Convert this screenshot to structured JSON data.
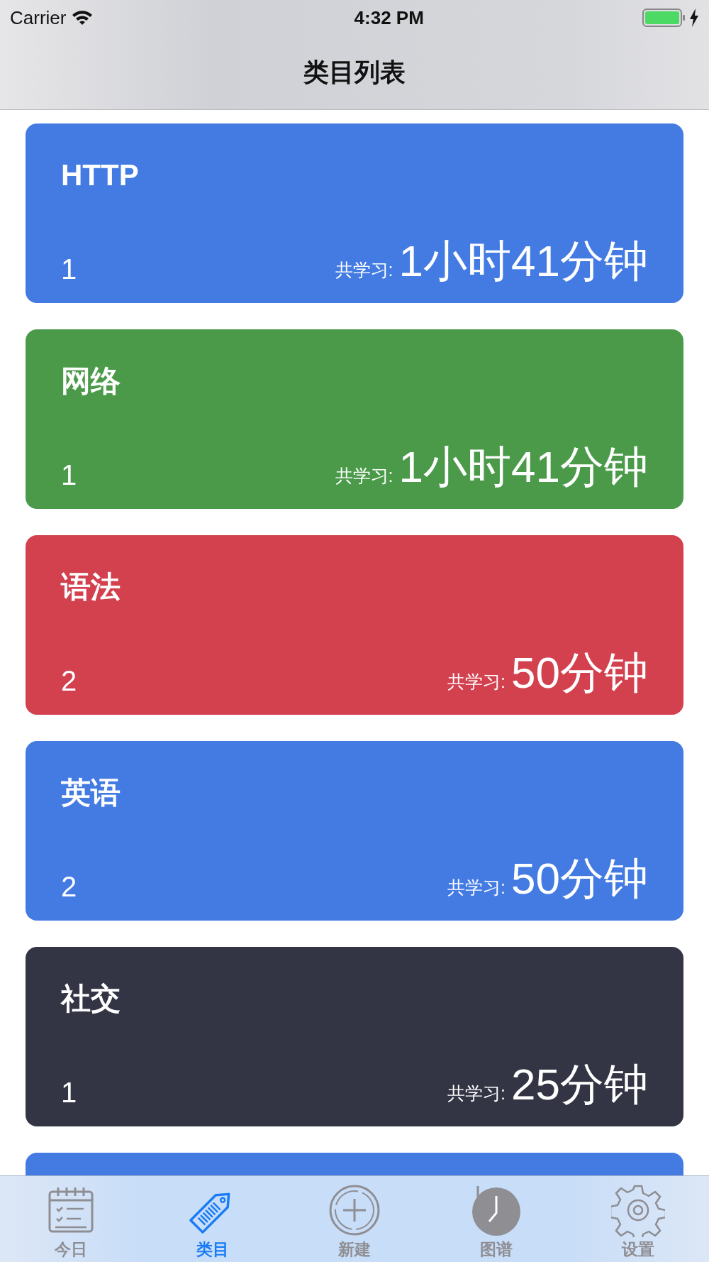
{
  "status_bar": {
    "carrier": "Carrier",
    "time": "4:32 PM"
  },
  "nav_bar": {
    "title": "类目列表"
  },
  "categories": [
    {
      "title": "HTTP",
      "count": "1",
      "label": "共学习:",
      "duration": "1小时41分钟",
      "color": "#437be3"
    },
    {
      "title": "网络",
      "count": "1",
      "label": "共学习:",
      "duration": "1小时41分钟",
      "color": "#4a9a4a"
    },
    {
      "title": "语法",
      "count": "2",
      "label": "共学习:",
      "duration": "50分钟",
      "color": "#d3414f"
    },
    {
      "title": "英语",
      "count": "2",
      "label": "共学习:",
      "duration": "50分钟",
      "color": "#437be3"
    },
    {
      "title": "社交",
      "count": "1",
      "label": "共学习:",
      "duration": "25分钟",
      "color": "#333444"
    },
    {
      "color": "#437be3"
    }
  ],
  "tab_bar": [
    {
      "kind": "calendar",
      "label": "今日",
      "selected": false
    },
    {
      "kind": "tag",
      "label": "类目",
      "selected": true
    },
    {
      "kind": "plus",
      "label": "新建",
      "selected": false
    },
    {
      "kind": "clock",
      "label": "图谱",
      "selected": false
    },
    {
      "kind": "gear",
      "label": "设置",
      "selected": false
    }
  ]
}
